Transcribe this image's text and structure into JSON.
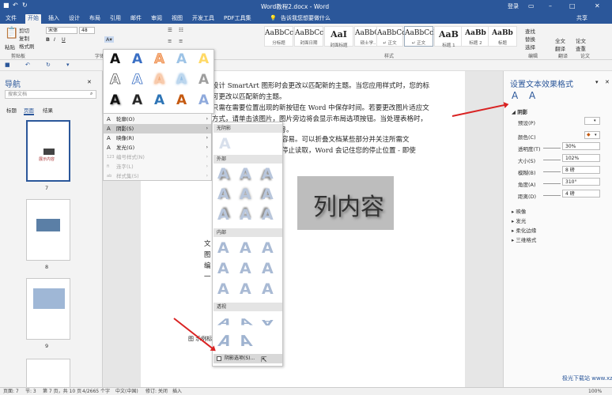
{
  "window": {
    "title": "Word教程2.docx - Word",
    "login": "登录",
    "share": "共享"
  },
  "tell_me": "告诉我您想要做什么",
  "tabs": [
    "文件",
    "开始",
    "插入",
    "设计",
    "布局",
    "引用",
    "邮件",
    "审阅",
    "视图",
    "开发工具",
    "PDF工具集"
  ],
  "ribbon": {
    "paste": "粘贴",
    "cut": "剪切",
    "copy": "复制",
    "format_painter": "格式刷",
    "clipboard": "剪贴板",
    "font_name": "宋体",
    "font_size": "48",
    "font_group": "字体",
    "styles_group": "样式",
    "styles": [
      {
        "sample": "AaBbCc",
        "name": "分标题"
      },
      {
        "sample": "AaBbCc",
        "name": "封面日期"
      },
      {
        "sample": "AaI",
        "name": "封面标题"
      },
      {
        "sample": "AaBbCc",
        "name": "硕士学..."
      },
      {
        "sample": "AaBbCc",
        "name": "↵ 正文"
      },
      {
        "sample": "AaBbCcD",
        "name": "↵ 正文"
      },
      {
        "sample": "AaB",
        "name": "标题 1"
      },
      {
        "sample": "AaBb",
        "name": "标题 2"
      },
      {
        "sample": "AaBb",
        "name": "标题"
      }
    ],
    "find": "查找",
    "replace": "替换",
    "select": "选择",
    "edit_group": "编辑",
    "translate": "全文翻译",
    "paper_check": "论文查重",
    "paper": "论文",
    "translate_group": "翻译"
  },
  "nav": {
    "title": "导航",
    "search_placeholder": "搜索文档",
    "tabs": [
      "标题",
      "页面",
      "结果"
    ],
    "pages": [
      "7",
      "8",
      "9"
    ],
    "thumb_title": "展示内容"
  },
  "document": {
    "lines": [
      "设计 SmartArt 图形时会更改以匹配新的主题。当您应用样式时，您的标",
      "可更改以匹配新的主题。",
      "只需在需要位置出现的新按钮在 Word 中保存时间。若要更改图片适应文",
      "方式，请单击该图片，图片旁边将会显示布局选项按钮。当处理表格时，",
      "单击加号。",
      "容易。可以折叠文档某些部分并关注所需文",
      "停止读取，Word 会记住您的停止位置 - 即使"
    ],
    "left_fragments": [
      "文",
      "图",
      "编",
      "一"
    ],
    "wordart": "列内容",
    "caption": "图 示例标"
  },
  "wordart_gallery": {
    "glyph": "A"
  },
  "text_effects_menu": [
    {
      "label": "轮廓(O)",
      "icon": "A",
      "enabled": true,
      "submenu": true
    },
    {
      "label": "阴影(S)",
      "icon": "A",
      "enabled": true,
      "submenu": true
    },
    {
      "label": "映像(R)",
      "icon": "A",
      "enabled": true,
      "submenu": true
    },
    {
      "label": "发光(G)",
      "icon": "A",
      "enabled": true,
      "submenu": true
    },
    {
      "label": "编号样式(N)",
      "icon": "123",
      "enabled": false,
      "submenu": true
    },
    {
      "label": "连字(L)",
      "icon": "fi",
      "enabled": false,
      "submenu": true
    },
    {
      "label": "样式集(S)",
      "icon": "ab",
      "enabled": false,
      "submenu": true
    }
  ],
  "shadow_submenu": {
    "none": "无阴影",
    "outer": "外部",
    "inner": "内部",
    "perspective": "透视",
    "options": "阴影选项(S)..."
  },
  "format_pane": {
    "title": "设置文本效果格式",
    "section_shadow": "阴影",
    "preset_label": "预设(P)",
    "color_label": "颜色(C)",
    "transparency_label": "透明度(T)",
    "transparency": "30%",
    "size_label": "大小(S)",
    "size": "102%",
    "blur_label": "模糊(B)",
    "blur": "8 磅",
    "angle_label": "角度(A)",
    "angle": "310°",
    "distance_label": "距离(D)",
    "distance": "4 磅",
    "sections": [
      "映像",
      "发光",
      "柔化边缘",
      "三维格式"
    ]
  },
  "status": {
    "page": "页面: 7",
    "section": "节: 3",
    "pages": "第 7 页，共 10 页",
    "words": "4/2665 个字",
    "lang": "中文(中国)",
    "track": "修订: 关闭",
    "insert": "插入",
    "zoom": "100%"
  },
  "watermark": "极光下载站 www.xz7.com",
  "accent": "#2b579a"
}
